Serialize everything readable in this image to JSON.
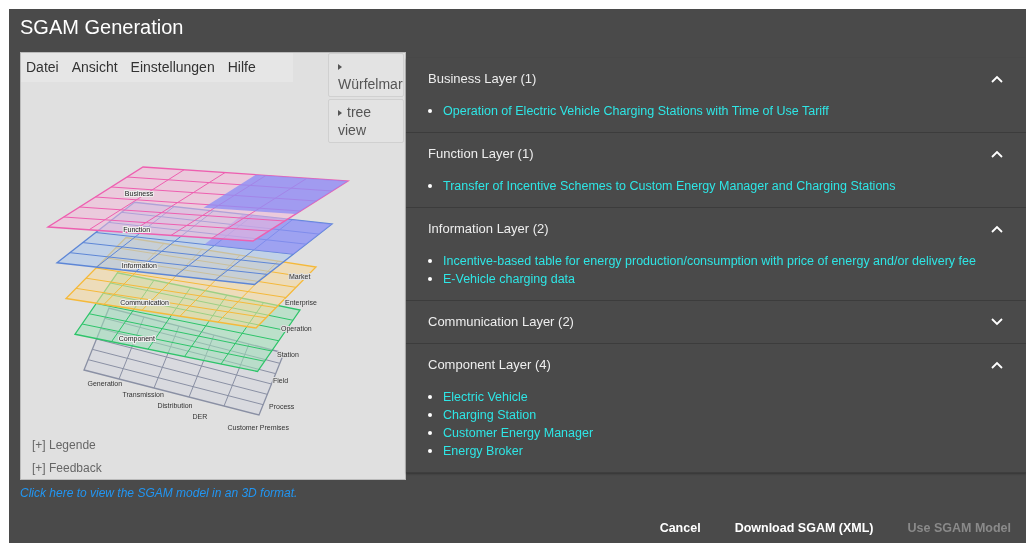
{
  "dialog": {
    "title": "SGAM Generation"
  },
  "viewer": {
    "menu": [
      "Datei",
      "Ansicht",
      "Einstellungen",
      "Hilfe"
    ],
    "panels": [
      {
        "label": "Würfelmar"
      },
      {
        "label": "tree view"
      }
    ],
    "layer_labels": [
      "Business",
      "Function",
      "Information",
      "Communication",
      "Component"
    ],
    "domain_labels": [
      "Generation",
      "Transmission",
      "Distribution",
      "DER",
      "Customer Premises"
    ],
    "zone_labels": [
      "Market",
      "Enterprise",
      "Operation",
      "Station",
      "Field",
      "Process"
    ],
    "toggles": [
      "[+] Legende",
      "[+] Feedback"
    ]
  },
  "view_3d_link": "Click here to view the SGAM model in an 3D format.",
  "layers": [
    {
      "title": "Business Layer (1)",
      "expanded": true,
      "items": [
        "Operation of Electric Vehicle Charging Stations with Time of Use Tariff"
      ]
    },
    {
      "title": "Function Layer (1)",
      "expanded": true,
      "items": [
        "Transfer of Incentive Schemes to Custom Energy Manager and Charging Stations"
      ]
    },
    {
      "title": "Information Layer (2)",
      "expanded": true,
      "items": [
        "Incentive-based table for energy production/consumption with price of energy and/or delivery fee",
        "E-Vehicle charging data"
      ]
    },
    {
      "title": "Communication Layer (2)",
      "expanded": false
    },
    {
      "title": "Component Layer (4)",
      "expanded": true,
      "items": [
        "Electric Vehicle",
        "Charging Station",
        "Customer Energy Manager",
        "Energy Broker"
      ]
    }
  ],
  "buttons": [
    {
      "label": "Cancel",
      "disabled": false
    },
    {
      "label": "Download SGAM (XML)",
      "disabled": false
    },
    {
      "label": "Use SGAM Model",
      "disabled": true
    }
  ]
}
